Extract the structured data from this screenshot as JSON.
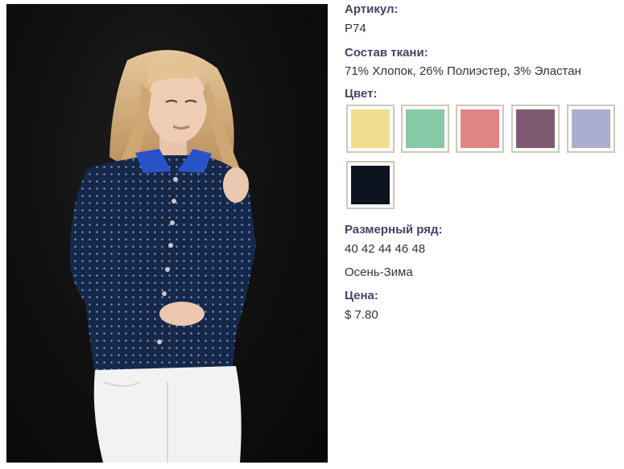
{
  "product": {
    "article_label": "Артикул:",
    "article_value": "P74",
    "fabric_label": "Состав ткани:",
    "fabric_value": "71% Хлопок, 26% Полиэстер, 3% Эластан",
    "color_label": "Цвет:",
    "colors": [
      "#f0dc8e",
      "#86c9a6",
      "#e08585",
      "#805a72",
      "#a9aed0",
      "#0d1420"
    ],
    "size_label": "Размерный ряд:",
    "size_value": "40 42 44 46 48",
    "season_value": "Осень-Зима",
    "price_label": "Цена:",
    "price_value": "$ 7.80"
  }
}
